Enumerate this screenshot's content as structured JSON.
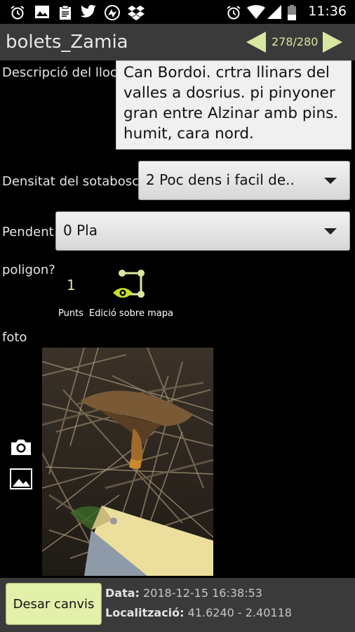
{
  "status_bar": {
    "time": "11:36",
    "icons": [
      "alarm-icon",
      "image-icon",
      "clipboard-icon",
      "twitter-icon",
      "browser-icon",
      "dropbox-icon",
      "alarm-icon",
      "wifi-icon",
      "signal-icon",
      "battery-icon"
    ]
  },
  "app_bar": {
    "title": "bolets_Zamia",
    "record_counter": "278/280",
    "accent_color": "#d8e7a0"
  },
  "form": {
    "location_label": "Descripció del lloc",
    "location_value": "Can Bordoi. crtra llinars del valles a dosrius. pi pinyoner gran entre Alzinar amb pins. humit, cara nord.",
    "density_label": "Densitat del sotabosc",
    "density_value": "2 Poc dens i facil de..",
    "slope_label": "Pendent",
    "slope_value": "0 Pla",
    "polygon_label": "poligon?",
    "points_count": "1",
    "points_label": "Punts",
    "map_edit_label": "Edició sobre mapa",
    "photo_label": "foto"
  },
  "bottom_bar": {
    "save_label": "Desar canvis",
    "date_label": "Data:",
    "date_value": "2018-12-15 16:38:53",
    "location_label": "Localització:",
    "location_value": "41.6240 - 2.40118"
  }
}
